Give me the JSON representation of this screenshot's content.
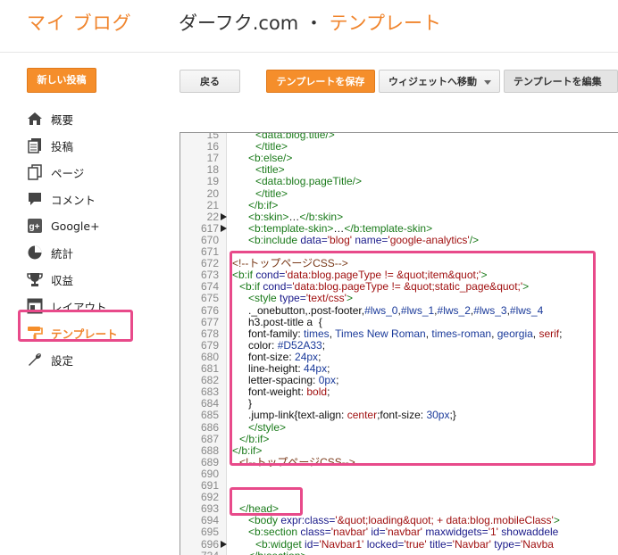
{
  "header": {
    "app_title": "マイ ブログ",
    "blog_name": "ダーフク.com",
    "separator": "・",
    "page_name": "テンプレート"
  },
  "sidebar": {
    "new_post_label": "新しい投稿",
    "items": [
      {
        "label": "概要",
        "icon": "home-icon"
      },
      {
        "label": "投稿",
        "icon": "posts-icon"
      },
      {
        "label": "ページ",
        "icon": "pages-icon"
      },
      {
        "label": "コメント",
        "icon": "comment-icon"
      },
      {
        "label": "Google+",
        "icon": "google-plus-icon"
      },
      {
        "label": "統計",
        "icon": "stats-pie-icon"
      },
      {
        "label": "収益",
        "icon": "trophy-icon"
      },
      {
        "label": "レイアウト",
        "icon": "layout-icon"
      },
      {
        "label": "テンプレート",
        "icon": "paint-roller-icon",
        "active": true
      },
      {
        "label": "設定",
        "icon": "wrench-icon"
      }
    ]
  },
  "toolbar": {
    "back_label": "戻る",
    "save_label": "テンプレートを保存",
    "widget_jump_label": "ウィジェットへ移動",
    "edit_label": "テンプレートを編集"
  },
  "colors": {
    "accent": "#f58e2b",
    "highlight": "#e84a8a",
    "code_tag": "#1a7a1a",
    "code_attr_value": "#a01010"
  },
  "editor": {
    "lines": [
      {
        "n": "15",
        "s": [
          [
            "t",
            "<data:blog.title/>"
          ]
        ]
      },
      {
        "n": "16",
        "s": [
          [
            "t",
            "</title>"
          ]
        ]
      },
      {
        "n": "17",
        "s": [
          [
            "t",
            "<b:else/>"
          ]
        ]
      },
      {
        "n": "18",
        "s": [
          [
            "t",
            "<title>"
          ]
        ]
      },
      {
        "n": "19",
        "s": [
          [
            "t",
            "<data:blog.pageTitle/>"
          ]
        ]
      },
      {
        "n": "20",
        "s": [
          [
            "t",
            "</title>"
          ]
        ]
      },
      {
        "n": "21",
        "s": [
          [
            "t",
            "</b:if>"
          ]
        ]
      },
      {
        "n": "22",
        "fold": true,
        "s": [
          [
            "t",
            "<b:skin>"
          ],
          [
            "tx",
            "…"
          ],
          [
            "t",
            "</b:skin>"
          ]
        ]
      },
      {
        "n": "617",
        "fold": true,
        "s": [
          [
            "t",
            "<b:template-skin>"
          ],
          [
            "tx",
            "…"
          ],
          [
            "t",
            "</b:template-skin>"
          ]
        ]
      },
      {
        "n": "670",
        "s": [
          [
            "t",
            "<b:include "
          ],
          [
            "an",
            "data="
          ],
          [
            "av",
            "'blog' "
          ],
          [
            "an",
            "name="
          ],
          [
            "av",
            "'google-analytics'"
          ],
          [
            "t",
            "/>"
          ]
        ]
      },
      {
        "n": "671",
        "s": []
      },
      {
        "n": "672",
        "s": [
          [
            "cm",
            "<!--トップページCSS-->"
          ]
        ]
      },
      {
        "n": "673",
        "s": [
          [
            "t",
            "<b:if "
          ],
          [
            "an",
            "cond="
          ],
          [
            "av",
            "'data:blog.pageType != &quot;item&quot;'"
          ],
          [
            "t",
            ">"
          ]
        ]
      },
      {
        "n": "674",
        "s": [
          [
            "t",
            "<b:if "
          ],
          [
            "an",
            "cond="
          ],
          [
            "av",
            "'data:blog.pageType != &quot;static_page&quot;'"
          ],
          [
            "t",
            ">"
          ]
        ]
      },
      {
        "n": "675",
        "s": [
          [
            "t",
            "<style "
          ],
          [
            "an",
            "type="
          ],
          [
            "av",
            "'text/css'"
          ],
          [
            "t",
            ">"
          ]
        ]
      },
      {
        "n": "676",
        "s": [
          [
            "tx",
            "._onebutton,.post-footer,"
          ],
          [
            "kw",
            "#lws_0"
          ],
          [
            "tx",
            ","
          ],
          [
            "kw",
            "#lws_1"
          ],
          [
            "tx",
            ","
          ],
          [
            "kw",
            "#lws_2"
          ],
          [
            "tx",
            ","
          ],
          [
            "kw",
            "#lws_3"
          ],
          [
            "tx",
            ","
          ],
          [
            "kw",
            "#lws_4"
          ]
        ]
      },
      {
        "n": "677",
        "s": [
          [
            "tx",
            "h3.post-title a  {"
          ]
        ]
      },
      {
        "n": "678",
        "s": [
          [
            "tx",
            "font-family: "
          ],
          [
            "kw",
            "times"
          ],
          [
            "tx",
            ", "
          ],
          [
            "kw",
            "Times New Roman"
          ],
          [
            "tx",
            ", "
          ],
          [
            "kw",
            "times-roman"
          ],
          [
            "tx",
            ", "
          ],
          [
            "kw",
            "georgia"
          ],
          [
            "tx",
            ", "
          ],
          [
            "av",
            "serif"
          ],
          [
            "tx",
            ";"
          ]
        ]
      },
      {
        "n": "679",
        "s": [
          [
            "tx",
            "color: "
          ],
          [
            "kw",
            "#D52A33"
          ],
          [
            "tx",
            ";"
          ]
        ]
      },
      {
        "n": "680",
        "s": [
          [
            "tx",
            "font-size: "
          ],
          [
            "kw",
            "24px"
          ],
          [
            "tx",
            ";"
          ]
        ]
      },
      {
        "n": "681",
        "s": [
          [
            "tx",
            "line-height: "
          ],
          [
            "kw",
            "44px"
          ],
          [
            "tx",
            ";"
          ]
        ]
      },
      {
        "n": "682",
        "s": [
          [
            "tx",
            "letter-spacing: "
          ],
          [
            "kw",
            "0px"
          ],
          [
            "tx",
            ";"
          ]
        ]
      },
      {
        "n": "683",
        "s": [
          [
            "tx",
            "font-weight: "
          ],
          [
            "av",
            "bold"
          ],
          [
            "tx",
            ";"
          ]
        ]
      },
      {
        "n": "684",
        "s": [
          [
            "tx",
            "}"
          ]
        ]
      },
      {
        "n": "685",
        "s": [
          [
            "tx",
            ".jump-link{text-align: "
          ],
          [
            "av",
            "center"
          ],
          [
            "tx",
            ";font-size: "
          ],
          [
            "kw",
            "30px"
          ],
          [
            "tx",
            ";}"
          ]
        ]
      },
      {
        "n": "686",
        "s": [
          [
            "t",
            "</style>"
          ]
        ]
      },
      {
        "n": "687",
        "s": [
          [
            "t",
            "</b:if>"
          ]
        ]
      },
      {
        "n": "688",
        "s": [
          [
            "t",
            "</b:if>"
          ]
        ]
      },
      {
        "n": "689",
        "s": [
          [
            "cm",
            "<!--トップページCSS-->"
          ]
        ]
      },
      {
        "n": "690",
        "s": []
      },
      {
        "n": "691",
        "s": []
      },
      {
        "n": "692",
        "s": []
      },
      {
        "n": "693",
        "s": [
          [
            "t",
            "</head>"
          ]
        ]
      },
      {
        "n": "694",
        "s": [
          [
            "t",
            "<body "
          ],
          [
            "an",
            "expr:class="
          ],
          [
            "av",
            "'&quot;loading&quot; + data:blog.mobileClass'"
          ],
          [
            "t",
            ">"
          ]
        ]
      },
      {
        "n": "695",
        "s": [
          [
            "t",
            "<b:section "
          ],
          [
            "an",
            "class="
          ],
          [
            "av",
            "'navbar' "
          ],
          [
            "an",
            "id="
          ],
          [
            "av",
            "'navbar' "
          ],
          [
            "an",
            "maxwidgets="
          ],
          [
            "av",
            "'1' "
          ],
          [
            "an",
            "showaddele"
          ]
        ]
      },
      {
        "n": "696",
        "fold": true,
        "s": [
          [
            "t",
            "<b:widget "
          ],
          [
            "an",
            "id="
          ],
          [
            "av",
            "'Navbar1' "
          ],
          [
            "an",
            "locked="
          ],
          [
            "av",
            "'true' "
          ],
          [
            "an",
            "title="
          ],
          [
            "av",
            "'Navbar' "
          ],
          [
            "an",
            "type="
          ],
          [
            "av",
            "'Navba"
          ]
        ]
      },
      {
        "n": "734",
        "s": [
          [
            "t",
            "</b:section>"
          ]
        ]
      }
    ]
  }
}
